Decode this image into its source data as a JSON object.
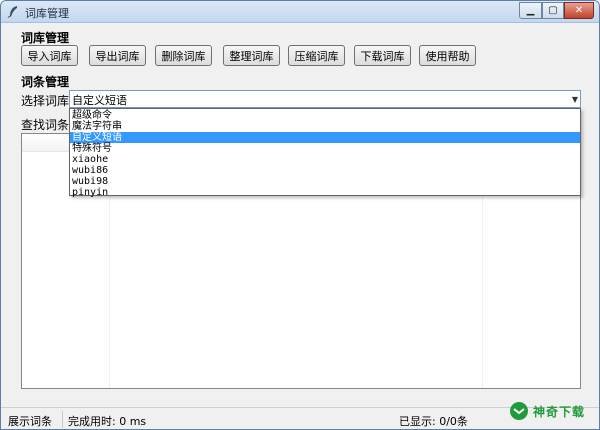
{
  "window": {
    "title": "词库管理"
  },
  "library_section": {
    "title": "词库管理",
    "buttons": [
      "导入词库",
      "导出词库",
      "删除词库",
      "整理词库",
      "压缩词库",
      "下载词库",
      "使用帮助"
    ]
  },
  "entry_section": {
    "title": "词条管理",
    "select_label": "选择词库",
    "selected_value": "自定义短语",
    "search_label": "查找词条",
    "options": [
      "超级命令",
      "魔法字符串",
      "自定义短语",
      "特殊符号",
      "xiaohe",
      "wubi86",
      "wubi98",
      "pinyin"
    ],
    "selected_index": 2
  },
  "status": {
    "mode": "展示词条",
    "elapsed": "完成用时: 0 ms",
    "shown": "已显示: 0/0条"
  },
  "watermark": {
    "text": "神奇下载"
  },
  "colors": {
    "selection": "#3399ff",
    "watermark_green": "#1f9b3b"
  }
}
